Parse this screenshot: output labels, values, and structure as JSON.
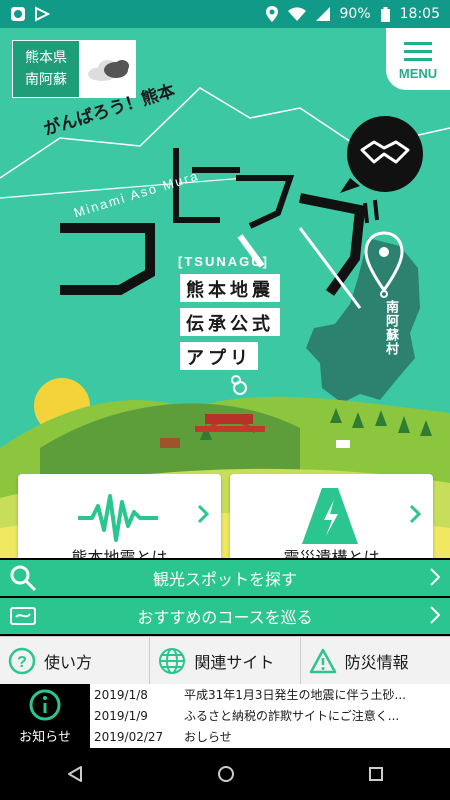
{
  "status_bar": {
    "battery": "90%",
    "time": "18:05",
    "icons": [
      "app-icon",
      "nav-app-icon",
      "location-icon",
      "wifi-icon",
      "signal-icon",
      "battery-icon"
    ]
  },
  "header": {
    "location_line1": "熊本県",
    "location_line2": "南阿蘇",
    "menu_label": "MENU"
  },
  "hero": {
    "slogan": "がんばろう！熊本",
    "romaji": "Minami Aso Mura",
    "tag": "[TSUNAGU]",
    "title_lines": [
      "熊本地震",
      "伝承公式",
      "アプリ"
    ],
    "village": "南阿蘇村"
  },
  "cards": [
    {
      "label": "熊本地震とは",
      "icon": "seismograph-icon"
    },
    {
      "label": "震災遺構とは",
      "icon": "ruins-icon"
    }
  ],
  "actions": [
    {
      "label": "観光スポットを探す",
      "icon": "search-icon"
    },
    {
      "label": "おすすめのコースを巡る",
      "icon": "map-icon"
    }
  ],
  "nav": [
    {
      "label": "使い方",
      "icon": "help-icon"
    },
    {
      "label": "関連サイト",
      "icon": "globe-icon"
    },
    {
      "label": "防災情報",
      "icon": "warning-icon"
    }
  ],
  "notices": {
    "button_label": "お知らせ",
    "items": [
      {
        "date": "2019/1/8",
        "title": "平成31年1月3日発生の地震に伴う土砂..."
      },
      {
        "date": "2019/1/9",
        "title": "ふるさと納税の詐欺サイトにご注意く..."
      },
      {
        "date": "2019/02/27",
        "title": "おしらせ"
      }
    ]
  },
  "colors": {
    "brand": "#2bc58f",
    "status": "#109a87",
    "hero": "#3dc8a4"
  }
}
